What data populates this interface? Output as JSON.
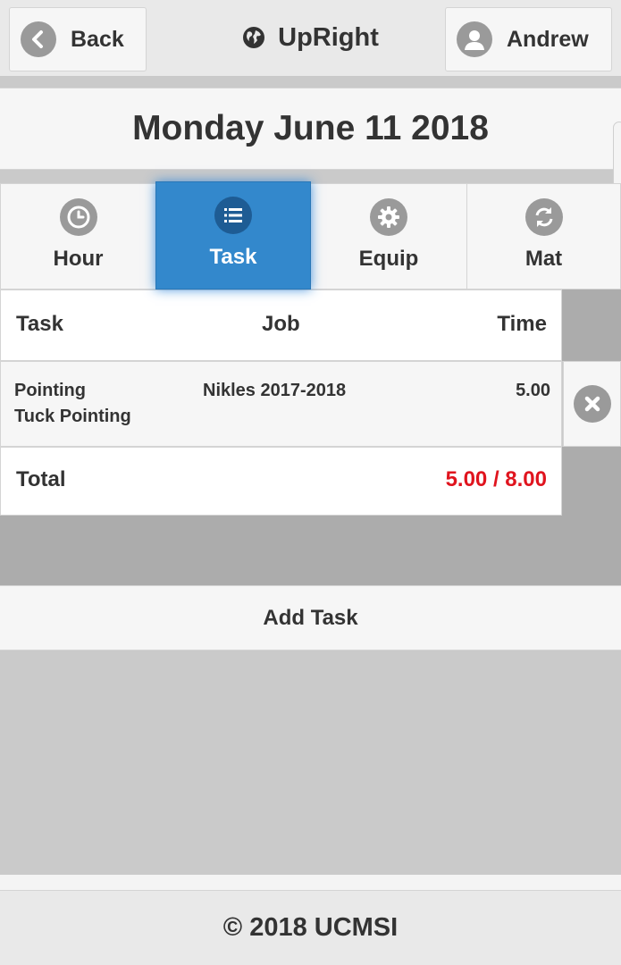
{
  "header": {
    "back_label": "Back",
    "app_title": "UpRight",
    "user_name": "Andrew"
  },
  "date_title": "Monday June 11 2018",
  "tabs": [
    {
      "label": "Hour",
      "icon": "clock-icon",
      "active": false
    },
    {
      "label": "Task",
      "icon": "list-icon",
      "active": true
    },
    {
      "label": "Equip",
      "icon": "gear-icon",
      "active": false
    },
    {
      "label": "Mat",
      "icon": "refresh-icon",
      "active": false
    }
  ],
  "table": {
    "columns": [
      "Task",
      "Job",
      "Time"
    ],
    "rows": [
      {
        "task_line1": "Pointing",
        "task_line2": "Tuck Pointing",
        "job": "Nikles 2017-2018",
        "time": "5.00"
      }
    ],
    "total_label": "Total",
    "total_value": "5.00 / 8.00"
  },
  "add_task_label": "Add Task",
  "footer_text": "© 2018 UCMSI",
  "colors": {
    "accent": "#3388cc",
    "total_red": "#e0141e",
    "icon_grey": "#9a9a9a"
  }
}
